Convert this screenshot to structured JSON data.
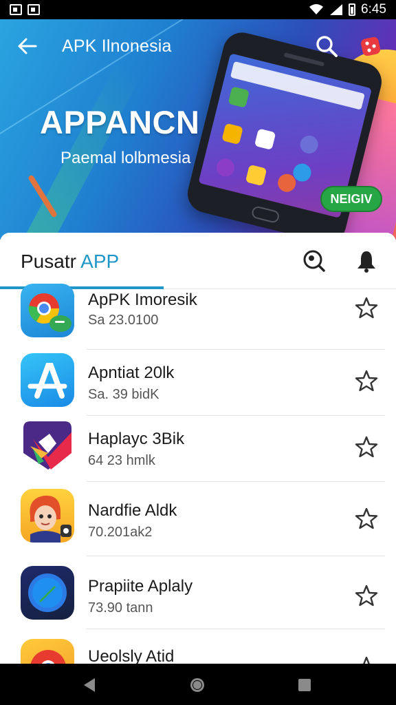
{
  "status_bar": {
    "time": "6:45"
  },
  "header": {
    "title": "APK Ilnonesia",
    "headline": "APPANCN",
    "subtitle": "Paemal lolbmesia",
    "badge_label": "NEIGIV"
  },
  "section": {
    "title_prefix": "Pusatr ",
    "title_accent": "APP"
  },
  "apps": [
    {
      "name": "ApPK Imoresik",
      "meta": "Sa 23.0100",
      "icon": "chrome-icon"
    },
    {
      "name": "Apntiat 20lk",
      "meta": "Sa. 39 bidK",
      "icon": "app-store-icon"
    },
    {
      "name": "Haplayc 3Bik",
      "meta": "64 23 hmlk",
      "icon": "play-icon"
    },
    {
      "name": "Nardfie Aldk",
      "meta": "70.201ak2",
      "icon": "character-icon"
    },
    {
      "name": "Prapiite Aplaly",
      "meta": "73.90 tann",
      "icon": "safari-icon"
    },
    {
      "name": "Ueolsly Atid",
      "meta": "",
      "icon": "chrome-alt-icon"
    }
  ],
  "colors": {
    "accent": "#1f96c8",
    "badge": "#26a644"
  }
}
